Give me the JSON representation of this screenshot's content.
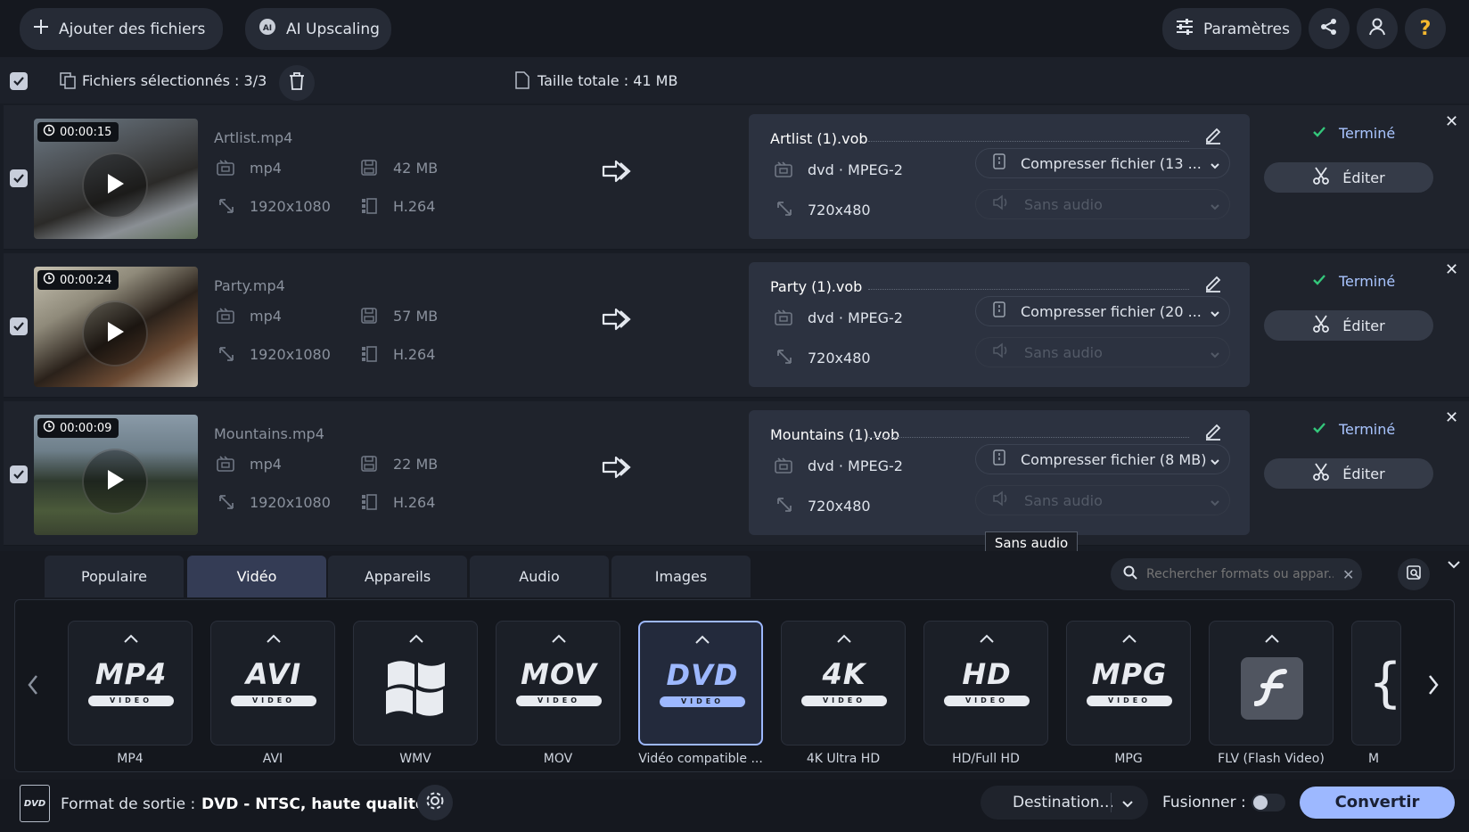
{
  "toolbar": {
    "add_files": "Ajouter des fichiers",
    "ai_upscaling": "AI Upscaling",
    "settings": "Paramètres"
  },
  "selection_bar": {
    "selected_label": "Fichiers sélectionnés : 3/3",
    "total_label": "Taille totale : 41 MB"
  },
  "files": [
    {
      "duration": "00:00:15",
      "name": "Artlist.mp4",
      "format": "mp4",
      "size": "42 MB",
      "resolution": "1920x1080",
      "codec": "H.264",
      "out_name": "Artlist (1).vob",
      "out_format": "dvd · MPEG-2",
      "out_resolution": "720x480",
      "compress": "Compresser fichier (13 ...",
      "audio": "Sans audio",
      "status": "Terminé",
      "edit": "Éditer"
    },
    {
      "duration": "00:00:24",
      "name": "Party.mp4",
      "format": "mp4",
      "size": "57 MB",
      "resolution": "1920x1080",
      "codec": "H.264",
      "out_name": "Party (1).vob",
      "out_format": "dvd · MPEG-2",
      "out_resolution": "720x480",
      "compress": "Compresser fichier (20 ...",
      "audio": "Sans audio",
      "status": "Terminé",
      "edit": "Éditer"
    },
    {
      "duration": "00:00:09",
      "name": "Mountains.mp4",
      "format": "mp4",
      "size": "22 MB",
      "resolution": "1920x1080",
      "codec": "H.264",
      "out_name": "Mountains (1).vob",
      "out_format": "dvd · MPEG-2",
      "out_resolution": "720x480",
      "compress": "Compresser fichier (8 MB)",
      "audio": "Sans audio",
      "status": "Terminé",
      "edit": "Éditer"
    }
  ],
  "tooltip": "Sans audio",
  "tabs": [
    "Populaire",
    "Vidéo",
    "Appareils",
    "Audio",
    "Images"
  ],
  "active_tab": "Vidéo",
  "search": {
    "placeholder": "Rechercher formats ou appar..."
  },
  "formats": [
    {
      "logo": "MP4",
      "sub": "VIDEO",
      "label": "MP4"
    },
    {
      "logo": "AVI",
      "sub": "VIDEO",
      "label": "AVI"
    },
    {
      "logo": "",
      "sub": "",
      "label": "WMV"
    },
    {
      "logo": "MOV",
      "sub": "VIDEO",
      "label": "MOV"
    },
    {
      "logo": "DVD",
      "sub": "VIDEO",
      "label": "Vidéo compatible ..."
    },
    {
      "logo": "4K",
      "sub": "VIDEO",
      "label": "4K Ultra HD"
    },
    {
      "logo": "HD",
      "sub": "VIDEO",
      "label": "HD/Full HD"
    },
    {
      "logo": "MPG",
      "sub": "VIDEO",
      "label": "MPG"
    },
    {
      "logo": "",
      "sub": "",
      "label": "FLV (Flash Video)"
    },
    {
      "logo": "",
      "sub": "",
      "label": "M"
    }
  ],
  "bottom": {
    "output_label": "Format de sortie :",
    "output_value": "DVD - NTSC, haute qualité",
    "destination": "Destination...",
    "merge": "Fusionner :",
    "convert": "Convertir"
  },
  "colors": {
    "accent": "#9db8ff",
    "selected_tab": "#343c55",
    "status": "#34c77b",
    "convert_bg": "#9db8ff"
  }
}
